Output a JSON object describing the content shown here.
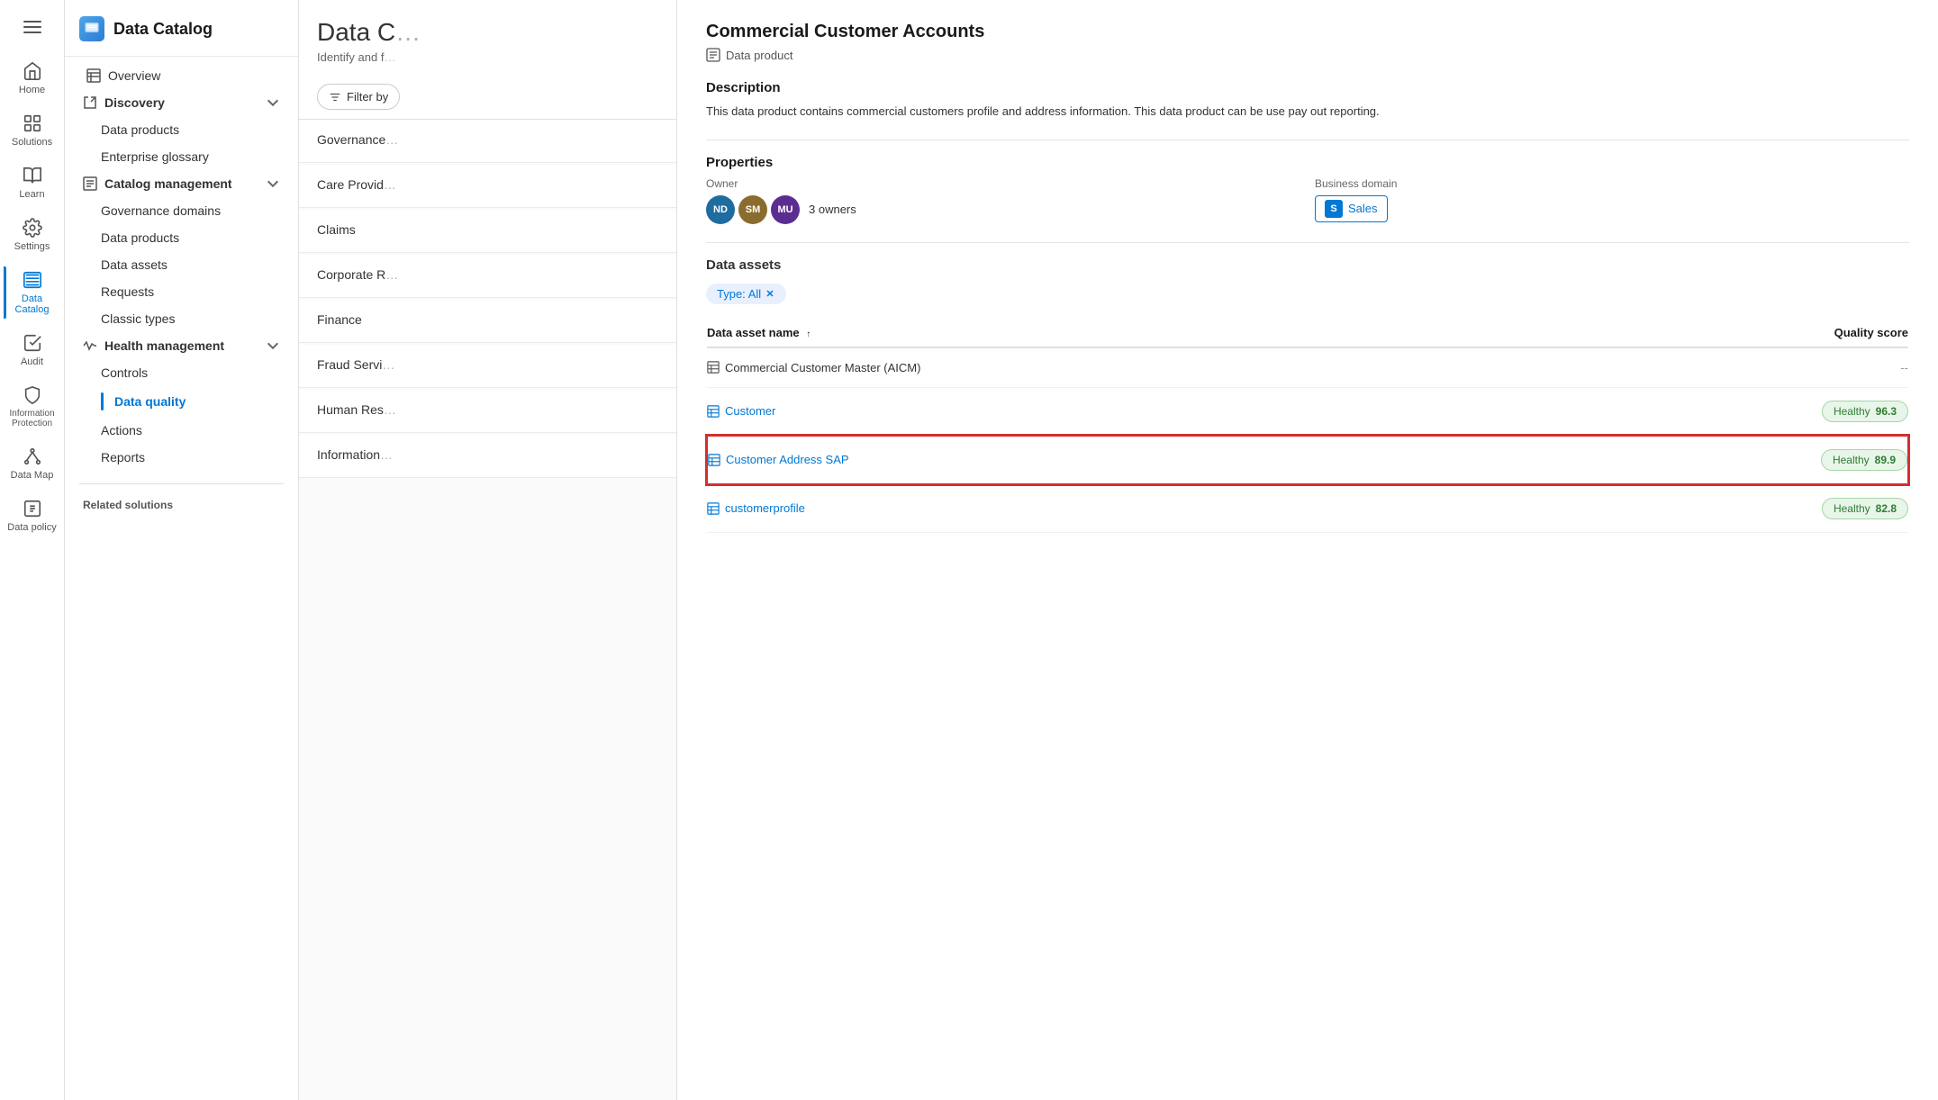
{
  "iconNav": {
    "hamburger": "menu",
    "items": [
      {
        "id": "home",
        "label": "Home",
        "icon": "home"
      },
      {
        "id": "solutions",
        "label": "Solutions",
        "icon": "solutions"
      },
      {
        "id": "learn",
        "label": "Learn",
        "icon": "learn"
      },
      {
        "id": "settings",
        "label": "Settings",
        "icon": "settings"
      },
      {
        "id": "data-catalog",
        "label": "Data Catalog",
        "icon": "catalog",
        "active": true
      },
      {
        "id": "audit",
        "label": "Audit",
        "icon": "audit"
      },
      {
        "id": "information-protection",
        "label": "Information Protection",
        "icon": "info-protection"
      },
      {
        "id": "data-map",
        "label": "Data Map",
        "icon": "data-map"
      },
      {
        "id": "data-policy",
        "label": "Data policy",
        "icon": "data-policy"
      }
    ]
  },
  "sidebar": {
    "title": "Data Catalog",
    "sections": [
      {
        "type": "item",
        "label": "Overview",
        "icon": "table",
        "indent": 0
      },
      {
        "type": "group",
        "label": "Discovery",
        "expanded": true,
        "children": [
          {
            "label": "Data products",
            "indent": 1
          },
          {
            "label": "Enterprise glossary",
            "indent": 1
          }
        ]
      },
      {
        "type": "group",
        "label": "Catalog management",
        "expanded": true,
        "children": [
          {
            "label": "Governance domains",
            "indent": 1
          },
          {
            "label": "Data products",
            "indent": 1
          },
          {
            "label": "Data assets",
            "indent": 1
          },
          {
            "label": "Requests",
            "indent": 1
          },
          {
            "label": "Classic types",
            "indent": 1
          }
        ]
      },
      {
        "type": "group",
        "label": "Health management",
        "expanded": true,
        "children": [
          {
            "label": "Controls",
            "indent": 1
          },
          {
            "label": "Data quality",
            "indent": 1,
            "active": true
          },
          {
            "label": "Actions",
            "indent": 1
          },
          {
            "label": "Reports",
            "indent": 1
          }
        ]
      }
    ],
    "divider": true,
    "relatedLabel": "Related solutions"
  },
  "catalogPanel": {
    "title": "Data C",
    "subtitle": "Identify and f",
    "filterLabel": "Filter by",
    "items": [
      {
        "name": "Governance",
        "sub": ""
      },
      {
        "name": "Care Provid",
        "sub": ""
      },
      {
        "name": "Claims",
        "sub": ""
      },
      {
        "name": "Corporate R",
        "sub": ""
      },
      {
        "name": "Finance",
        "sub": ""
      },
      {
        "name": "Fraud Servi",
        "sub": ""
      },
      {
        "name": "Human Res",
        "sub": ""
      },
      {
        "name": "Information",
        "sub": ""
      }
    ]
  },
  "detailPanel": {
    "title": "Commercial Customer Accounts",
    "typeLabel": "Data product",
    "descriptionTitle": "Description",
    "description": "This data product contains commercial customers profile and address information. This data product can be use pay out reporting.",
    "propertiesTitle": "Properties",
    "ownerLabel": "Owner",
    "owners": [
      {
        "initials": "ND",
        "colorClass": "avatar-nd"
      },
      {
        "initials": "SM",
        "colorClass": "avatar-sm"
      },
      {
        "initials": "MU",
        "colorClass": "avatar-mu"
      }
    ],
    "ownerCount": "3 owners",
    "businessDomainLabel": "Business domain",
    "businessDomainInitial": "S",
    "businessDomainName": "Sales",
    "dataAssetsTitle": "Data assets",
    "typeFilterLabel": "Type: All",
    "tableHeaders": {
      "name": "Data asset name",
      "qualityScore": "Quality score"
    },
    "assets": [
      {
        "id": "commercial-customer-master",
        "name": "Commercial Customer Master (AICM)",
        "link": false,
        "qualityScore": "--",
        "hasScore": false
      },
      {
        "id": "customer",
        "name": "Customer",
        "link": true,
        "qualityScore": "96.3",
        "qualityLabel": "Healthy",
        "hasScore": true
      },
      {
        "id": "customer-address-sap",
        "name": "Customer Address SAP",
        "link": true,
        "qualityScore": "89.9",
        "qualityLabel": "Healthy",
        "hasScore": true,
        "highlighted": true
      },
      {
        "id": "customerprofile",
        "name": "customerprofile",
        "link": true,
        "qualityScore": "82.8",
        "qualityLabel": "Healthy",
        "hasScore": true
      }
    ]
  }
}
